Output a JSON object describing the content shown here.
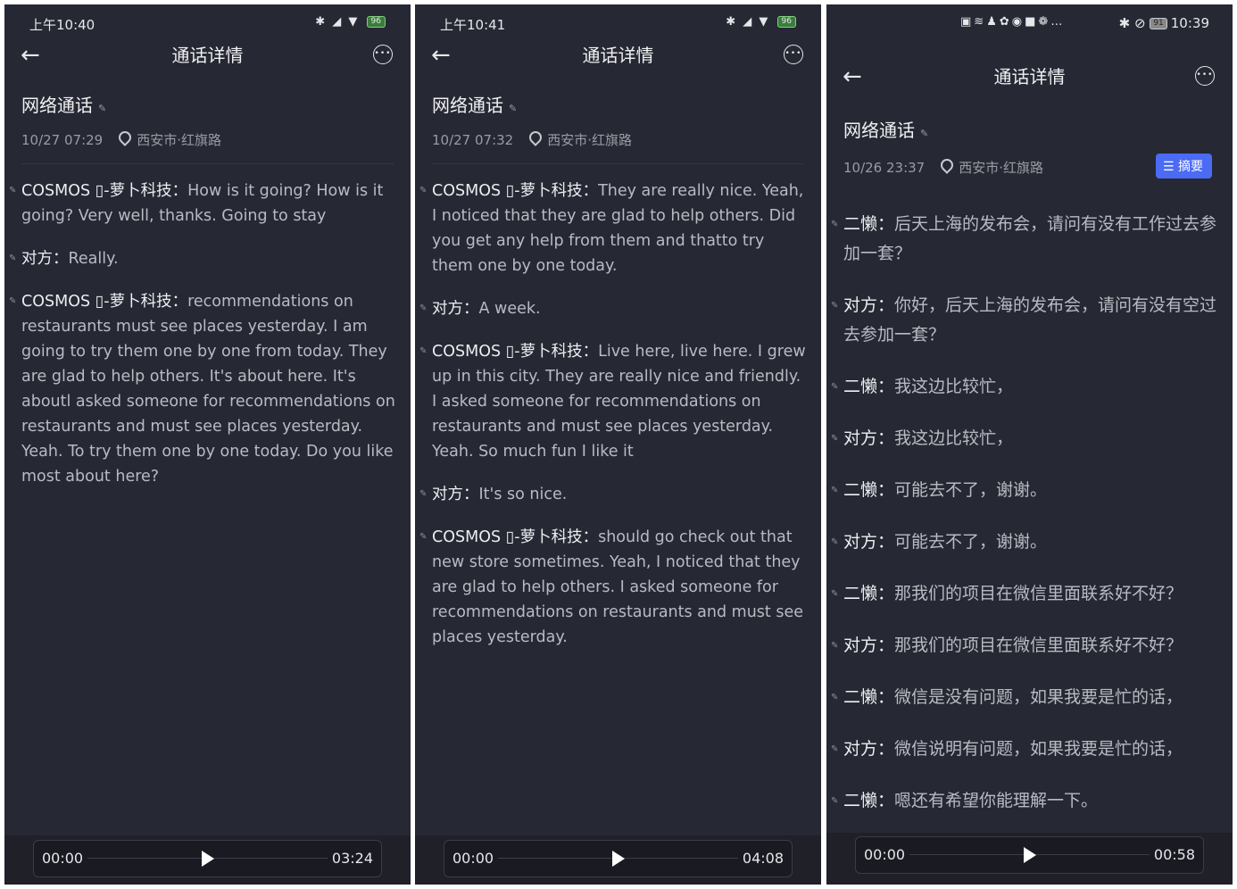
{
  "screens": [
    {
      "status_time": "上午10:40",
      "battery": "96",
      "header_title": "通话详情",
      "call_title": "网络通话",
      "datetime": "10/27 07:29",
      "location": "西安市·红旗路",
      "turns": [
        {
          "speaker": "COSMOS ▯-萝卜科技：",
          "text": "How is it going? How is it going? Very well, thanks. Going to stay"
        },
        {
          "speaker": "对方：",
          "text": "Really."
        },
        {
          "speaker": "COSMOS ▯-萝卜科技：",
          "text": "recommendations on restaurants must see places yesterday. I am going to try them one by one from today. They are glad to help others. It's about here. It's aboutl asked someone for recommendations on restaurants and must see places yesterday. Yeah. To try them one by one today. Do you like most about here?"
        }
      ],
      "player": {
        "start": "00:00",
        "end": "03:24"
      }
    },
    {
      "status_time": "上午10:41",
      "battery": "96",
      "header_title": "通话详情",
      "call_title": "网络通话",
      "datetime": "10/27 07:32",
      "location": "西安市·红旗路",
      "turns": [
        {
          "speaker": "COSMOS ▯-萝卜科技：",
          "text": "They are really nice. Yeah, I noticed that they are glad to help others. Did you get any help from them and thatto try them one by one today."
        },
        {
          "speaker": "对方：",
          "text": "A week."
        },
        {
          "speaker": "COSMOS ▯-萝卜科技：",
          "text": "Live here, live here. I grew up in this city. They are really nice and friendly. I asked someone for recommendations on restaurants and must see places yesterday. Yeah. So much fun I like it"
        },
        {
          "speaker": "对方：",
          "text": "It's so nice."
        },
        {
          "speaker": "COSMOS ▯-萝卜科技：",
          "text": "should go check out that new store sometimes. Yeah, I noticed that they are glad to help others. I asked someone for recommendations on restaurants and must see places yesterday."
        }
      ],
      "player": {
        "start": "00:00",
        "end": "04:08"
      }
    },
    {
      "status_time": "10:39",
      "battery": "91",
      "header_title": "通话详情",
      "call_title": "网络通话",
      "datetime": "10/26 23:37",
      "location": "西安市·红旗路",
      "summary_badge": "摘要",
      "turns": [
        {
          "speaker": "二懒：",
          "text": "后天上海的发布会，请问有没有工作过去参加一套？"
        },
        {
          "speaker": "对方：",
          "text": "你好，后天上海的发布会，请问有没有空过去参加一套？"
        },
        {
          "speaker": "二懒：",
          "text": "我这边比较忙，"
        },
        {
          "speaker": "对方：",
          "text": "我这边比较忙，"
        },
        {
          "speaker": "二懒：",
          "text": "可能去不了，谢谢。"
        },
        {
          "speaker": "对方：",
          "text": "可能去不了，谢谢。"
        },
        {
          "speaker": "二懒：",
          "text": "那我们的项目在微信里面联系好不好？"
        },
        {
          "speaker": "对方：",
          "text": "那我们的项目在微信里面联系好不好？"
        },
        {
          "speaker": "二懒：",
          "text": "微信是没有问题，如果我要是忙的话，"
        },
        {
          "speaker": "对方：",
          "text": "微信说明有问题，如果我要是忙的话，"
        },
        {
          "speaker": "二懒：",
          "text": "嗯还有希望你能理解一下。"
        }
      ],
      "player": {
        "start": "00:00",
        "end": "00:58"
      }
    }
  ]
}
